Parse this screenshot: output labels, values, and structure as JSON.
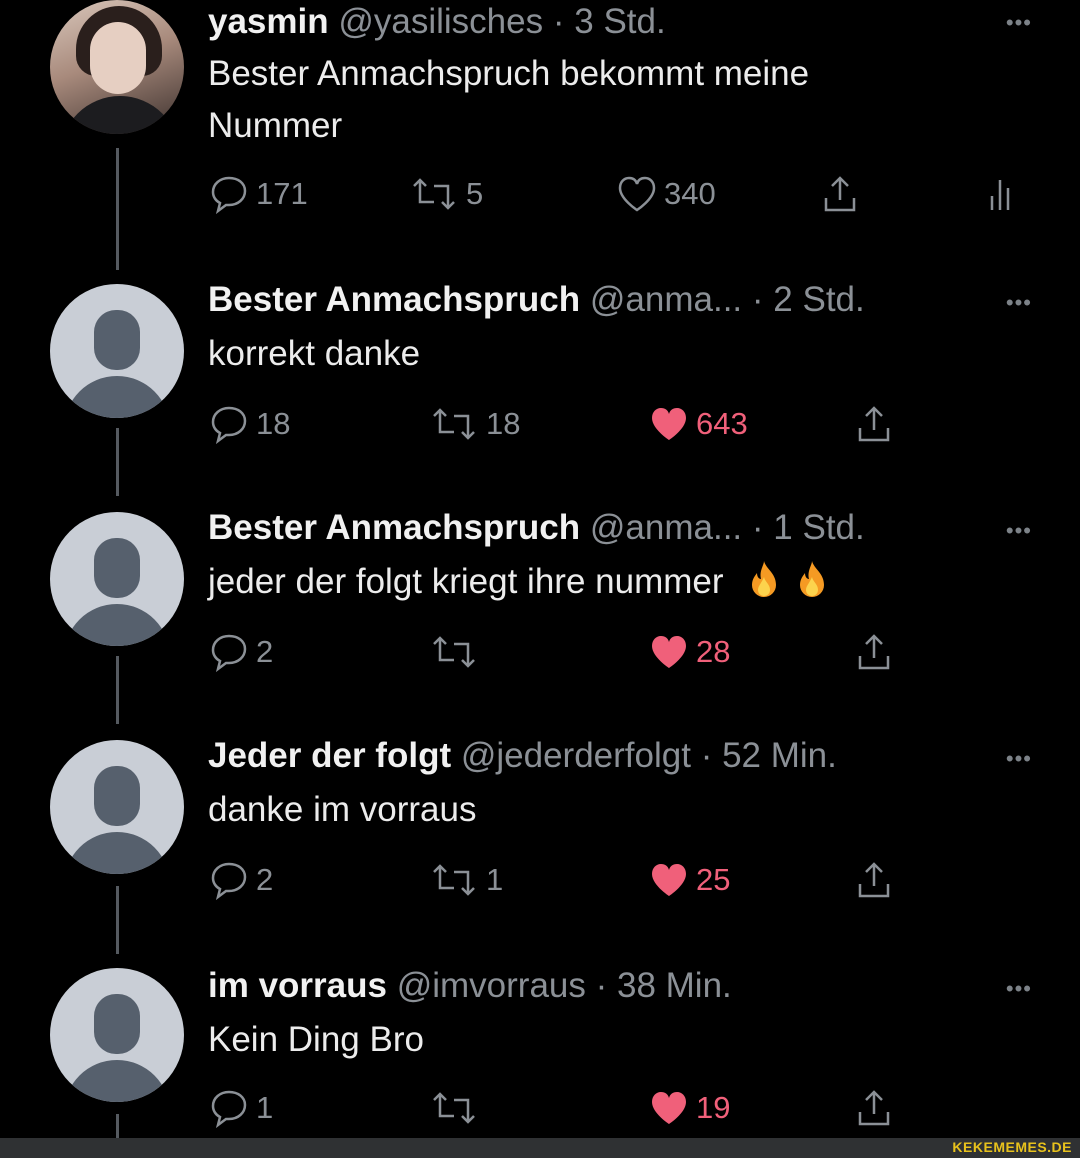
{
  "tweets": [
    {
      "name": "yasmin",
      "handle": "@yasilisches",
      "time": "3 Std.",
      "text": "Bester Anmachspruch bekommt meine Nummer",
      "replies": "171",
      "retweets": "5",
      "likes": "340",
      "liked": false,
      "avatar": "profile-photo"
    },
    {
      "name": "Bester Anmachspruch",
      "handle": "@anma...",
      "time": "2 Std.",
      "text": "korrekt danke",
      "replies": "18",
      "retweets": "18",
      "likes": "643",
      "liked": true,
      "avatar": "default-avatar"
    },
    {
      "name": "Bester Anmachspruch",
      "handle": "@anma...",
      "time": "1 Std.",
      "text": "jeder der folgt kriegt ihre nummer",
      "emoji": "🔥🔥",
      "replies": "2",
      "retweets": "",
      "likes": "28",
      "liked": true,
      "avatar": "default-avatar"
    },
    {
      "name": "Jeder der folgt",
      "handle": "@jederderfolgt",
      "time": "52 Min.",
      "text": "danke im vorraus",
      "replies": "2",
      "retweets": "1",
      "likes": "25",
      "liked": true,
      "avatar": "default-avatar"
    },
    {
      "name": "im vorraus",
      "handle": "@imvorraus",
      "time": "38 Min.",
      "text": "Kein Ding Bro",
      "replies": "1",
      "retweets": "",
      "likes": "19",
      "liked": true,
      "avatar": "default-avatar"
    }
  ],
  "separator": "·",
  "more_label": "•••",
  "watermark": "KEKEMEMES.DE",
  "colors": {
    "background": "#000000",
    "like_active": "#f0607a",
    "muted": "#8b9096",
    "watermark": "#e8c21c"
  },
  "icons": [
    "reply-icon",
    "retweet-icon",
    "heart-icon",
    "share-icon",
    "analytics-icon",
    "fire-emoji"
  ]
}
